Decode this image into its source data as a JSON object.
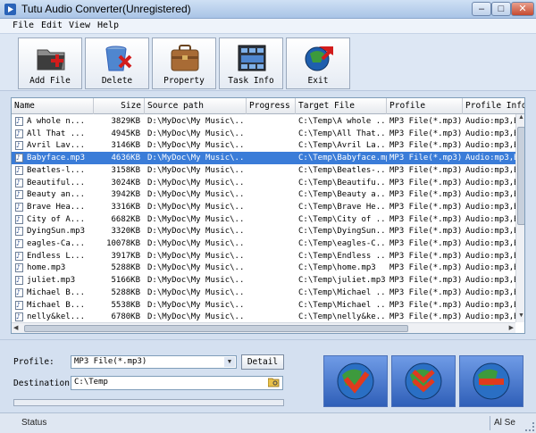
{
  "window": {
    "title": "Tutu Audio Converter(Unregistered)",
    "min": "–",
    "max": "□",
    "close": "✕"
  },
  "menu": [
    "File",
    "Edit",
    "View",
    "Help"
  ],
  "toolbar": [
    {
      "label": "Add File",
      "icon": "add-file-icon"
    },
    {
      "label": "Delete",
      "icon": "delete-icon"
    },
    {
      "label": "Property",
      "icon": "property-icon"
    },
    {
      "label": "Task Info",
      "icon": "task-info-icon"
    },
    {
      "label": "Exit",
      "icon": "exit-icon"
    }
  ],
  "columns": [
    "Name",
    "Size",
    "Source path",
    "Progress",
    "Target File",
    "Profile",
    "Profile Info"
  ],
  "files": [
    {
      "name": "A whole n...",
      "size": "3829KB",
      "src": "D:\\MyDoc\\My Music\\...",
      "progress": "",
      "target": "C:\\Temp\\A whole ...",
      "profile": "MP3 File(*.mp3)",
      "info": "Audio:mp3,Bit"
    },
    {
      "name": "All That ...",
      "size": "4945KB",
      "src": "D:\\MyDoc\\My Music\\...",
      "progress": "",
      "target": "C:\\Temp\\All That...",
      "profile": "MP3 File(*.mp3)",
      "info": "Audio:mp3,Bit"
    },
    {
      "name": "Avril Lav...",
      "size": "3146KB",
      "src": "D:\\MyDoc\\My Music\\...",
      "progress": "",
      "target": "C:\\Temp\\Avril La...",
      "profile": "MP3 File(*.mp3)",
      "info": "Audio:mp3,Bit"
    },
    {
      "name": "Babyface.mp3",
      "size": "4636KB",
      "src": "D:\\MyDoc\\My Music\\...",
      "progress": "",
      "target": "C:\\Temp\\Babyface.mp3",
      "profile": "MP3 File(*.mp3)",
      "info": "Audio:mp3,Bit"
    },
    {
      "name": "Beatles-l...",
      "size": "3158KB",
      "src": "D:\\MyDoc\\My Music\\...",
      "progress": "",
      "target": "C:\\Temp\\Beatles-...",
      "profile": "MP3 File(*.mp3)",
      "info": "Audio:mp3,Bit"
    },
    {
      "name": "Beautiful...",
      "size": "3024KB",
      "src": "D:\\MyDoc\\My Music\\...",
      "progress": "",
      "target": "C:\\Temp\\Beautifu...",
      "profile": "MP3 File(*.mp3)",
      "info": "Audio:mp3,Bit"
    },
    {
      "name": "Beauty an...",
      "size": "3942KB",
      "src": "D:\\MyDoc\\My Music\\...",
      "progress": "",
      "target": "C:\\Temp\\Beauty a...",
      "profile": "MP3 File(*.mp3)",
      "info": "Audio:mp3,Bit"
    },
    {
      "name": "Brave Hea...",
      "size": "3316KB",
      "src": "D:\\MyDoc\\My Music\\...",
      "progress": "",
      "target": "C:\\Temp\\Brave He...",
      "profile": "MP3 File(*.mp3)",
      "info": "Audio:mp3,Bit"
    },
    {
      "name": "City of A...",
      "size": "6682KB",
      "src": "D:\\MyDoc\\My Music\\...",
      "progress": "",
      "target": "C:\\Temp\\City of ...",
      "profile": "MP3 File(*.mp3)",
      "info": "Audio:mp3,Bit"
    },
    {
      "name": "DyingSun.mp3",
      "size": "3320KB",
      "src": "D:\\MyDoc\\My Music\\...",
      "progress": "",
      "target": "C:\\Temp\\DyingSun...",
      "profile": "MP3 File(*.mp3)",
      "info": "Audio:mp3,Bit"
    },
    {
      "name": "eagles-Ca...",
      "size": "10078KB",
      "src": "D:\\MyDoc\\My Music\\...",
      "progress": "",
      "target": "C:\\Temp\\eagles-C...",
      "profile": "MP3 File(*.mp3)",
      "info": "Audio:mp3,Bit"
    },
    {
      "name": "Endless L...",
      "size": "3917KB",
      "src": "D:\\MyDoc\\My Music\\...",
      "progress": "",
      "target": "C:\\Temp\\Endless ...",
      "profile": "MP3 File(*.mp3)",
      "info": "Audio:mp3,Bit"
    },
    {
      "name": "home.mp3",
      "size": "5288KB",
      "src": "D:\\MyDoc\\My Music\\...",
      "progress": "",
      "target": "C:\\Temp\\home.mp3",
      "profile": "MP3 File(*.mp3)",
      "info": "Audio:mp3,Bit"
    },
    {
      "name": "juliet.mp3",
      "size": "5166KB",
      "src": "D:\\MyDoc\\My Music\\...",
      "progress": "",
      "target": "C:\\Temp\\juliet.mp3",
      "profile": "MP3 File(*.mp3)",
      "info": "Audio:mp3,Bit"
    },
    {
      "name": "Michael B...",
      "size": "5288KB",
      "src": "D:\\MyDoc\\My Music\\...",
      "progress": "",
      "target": "C:\\Temp\\Michael ...",
      "profile": "MP3 File(*.mp3)",
      "info": "Audio:mp3,Bit"
    },
    {
      "name": "Michael B...",
      "size": "5538KB",
      "src": "D:\\MyDoc\\My Music\\...",
      "progress": "",
      "target": "C:\\Temp\\Michael ...",
      "profile": "MP3 File(*.mp3)",
      "info": "Audio:mp3,Bit"
    },
    {
      "name": "nelly&kel...",
      "size": "6780KB",
      "src": "D:\\MyDoc\\My Music\\...",
      "progress": "",
      "target": "C:\\Temp\\nelly&ke...",
      "profile": "MP3 File(*.mp3)",
      "info": "Audio:mp3,Bit"
    }
  ],
  "selected_index": 3,
  "options": {
    "profile_label": "Profile:",
    "profile_value": "MP3 File(*.mp3)",
    "detail_label": "Detail",
    "destination_label": "Destination:",
    "destination_value": "C:\\Temp",
    "progress": 0
  },
  "action_buttons": [
    {
      "icon": "convert-globe-icon"
    },
    {
      "icon": "convert-all-globe-icon"
    },
    {
      "icon": "stop-globe-icon"
    }
  ],
  "status": {
    "left": "Status",
    "right": "Al Se"
  },
  "colors": {
    "selection": "#3a7cd8",
    "accent": "#2f5fb8"
  }
}
